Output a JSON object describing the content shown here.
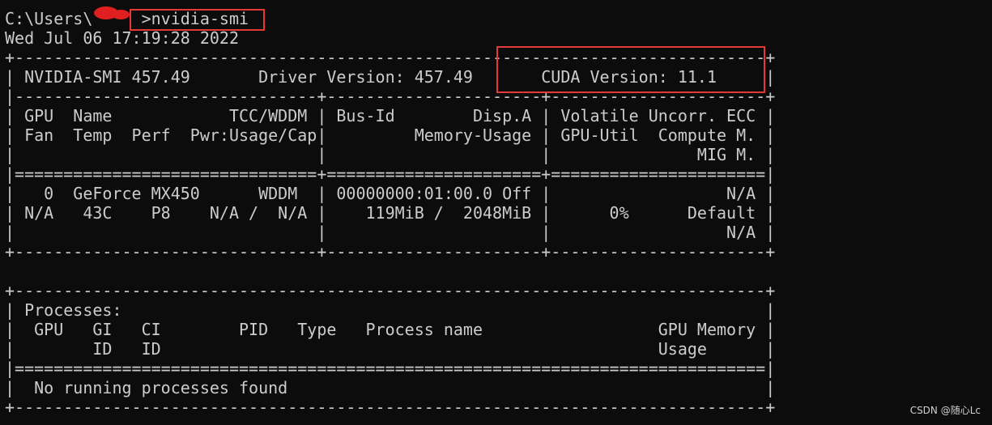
{
  "terminal": {
    "lines": [
      "C:\\Users\\     >nvidia-smi",
      "Wed Jul 06 17:19:28 2022",
      "+-----------------------------------------------------------------------------+",
      "| NVIDIA-SMI 457.49       Driver Version: 457.49       CUDA Version: 11.1     |",
      "|-------------------------------+----------------------+----------------------+",
      "| GPU  Name            TCC/WDDM | Bus-Id        Disp.A | Volatile Uncorr. ECC |",
      "| Fan  Temp  Perf  Pwr:Usage/Cap|         Memory-Usage | GPU-Util  Compute M. |",
      "|                               |                      |               MIG M. |",
      "|===============================+======================+======================|",
      "|   0  GeForce MX450      WDDM  | 00000000:01:00.0 Off |                  N/A |",
      "| N/A   43C    P8    N/A /  N/A |    119MiB /  2048MiB |      0%      Default |",
      "|                               |                      |                  N/A |",
      "+-------------------------------+----------------------+----------------------+",
      "",
      "+-----------------------------------------------------------------------------+",
      "| Processes:                                                                  |",
      "|  GPU   GI   CI        PID   Type   Process name                  GPU Memory |",
      "|        ID   ID                                                   Usage      |",
      "|=============================================================================|",
      "|  No running processes found                                                 |",
      "+-----------------------------------------------------------------------------+"
    ]
  },
  "annotation_color": "#e53935",
  "watermark": "CSDN @随心Lc"
}
